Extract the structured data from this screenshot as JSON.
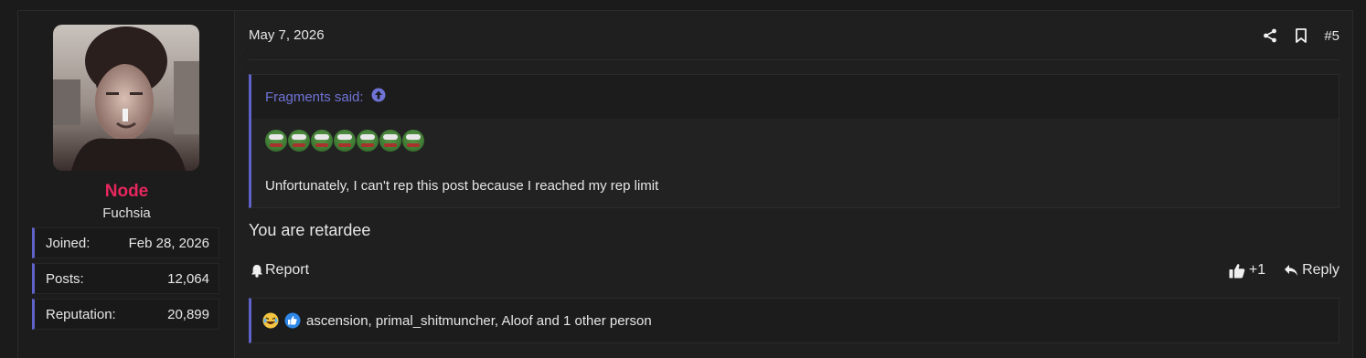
{
  "user": {
    "name": "Node",
    "title": "Fuchsia",
    "stats": [
      {
        "label": "Joined:",
        "value": "Feb 28, 2026"
      },
      {
        "label": "Posts:",
        "value": "12,064"
      },
      {
        "label": "Reputation:",
        "value": "20,899"
      }
    ]
  },
  "post": {
    "date": "May 7, 2026",
    "number": "#5",
    "quote": {
      "author_line": "Fragments said:",
      "emoji_icon": "pepe-laugh-emoji",
      "emoji_count": 7,
      "text": "Unfortunately, I can't rep this post because I reached my rep limit"
    },
    "message": "You are retardee",
    "actions": {
      "report": "Report",
      "like": "+1",
      "reply": "Reply"
    },
    "reactions_text": "ascension, primal_shitmuncher, Aloof and 1 other person"
  },
  "colors": {
    "accent": "#5f62c8",
    "username": "#e8265e",
    "quote_author": "#6f73d6"
  }
}
